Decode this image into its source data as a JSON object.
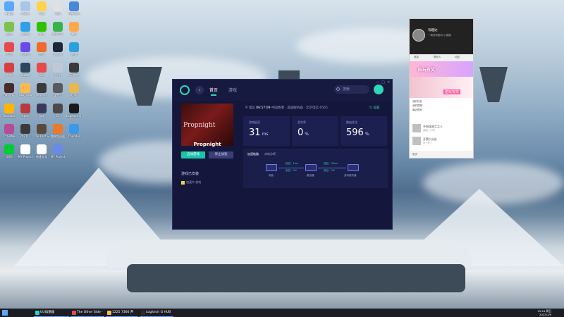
{
  "desktop": {
    "icons": [
      {
        "label": "计算机",
        "color": "#5aa7ff"
      },
      {
        "label": "回收站",
        "color": "#a8c6e8"
      },
      {
        "label": "工具",
        "color": "#ffd24a"
      },
      {
        "label": "文档",
        "color": "#e0e0e0"
      },
      {
        "label": "控制面板",
        "color": "#4a86d8"
      },
      {
        "label": "网盘",
        "color": "#7fc24a"
      },
      {
        "label": "浏览器",
        "color": "#2fa0e8"
      },
      {
        "label": "微信",
        "color": "#2dc100"
      },
      {
        "label": "安全卫士",
        "color": "#3ab34a"
      },
      {
        "label": "腾讯",
        "color": "#ffa94a"
      },
      {
        "label": "游戏",
        "color": "#e84a4a"
      },
      {
        "label": "加速器",
        "color": "#6a4ae8"
      },
      {
        "label": "音乐",
        "color": "#f06a2a"
      },
      {
        "label": "Steam",
        "color": "#1b2838"
      },
      {
        "label": "视频",
        "color": "#2aa0e0"
      },
      {
        "label": "雷神",
        "color": "#d84040"
      },
      {
        "label": "Steam",
        "color": "#2a475e"
      },
      {
        "label": "EA",
        "color": "#e84a4a"
      },
      {
        "label": "图片",
        "color": "#c0c8d8"
      },
      {
        "label": "云游戏",
        "color": "#3a3a3a"
      },
      {
        "label": "Dead by",
        "color": "#4a2a2a"
      },
      {
        "label": "WeGame",
        "color": "#ffb84a"
      },
      {
        "label": "Phasmo",
        "color": "#3a3a3a"
      },
      {
        "label": "游戏2",
        "color": "#5a5a5a"
      },
      {
        "label": "GTA",
        "color": "#e8b84a"
      },
      {
        "label": "Rockstar",
        "color": "#ffb400"
      },
      {
        "label": "Apex",
        "color": "#b83a3a"
      },
      {
        "label": "游戏",
        "color": "#3a3a5a"
      },
      {
        "label": "CF",
        "color": "#4a4a4a"
      },
      {
        "label": "Logitech G HUB",
        "color": "#1a1a1a"
      },
      {
        "label": "CYGAMe",
        "color": "#b84a9a"
      },
      {
        "label": "202111",
        "color": "#3a3a3a"
      },
      {
        "label": "The Last Sword",
        "color": "#5a4a3a"
      },
      {
        "label": "雷神加速器",
        "color": "#e87a2a"
      },
      {
        "label": "Thunder",
        "color": "#3a9ae8"
      },
      {
        "label": "iQIYI",
        "color": "#00cc36"
      },
      {
        "label": "MY Project",
        "color": "#ffffff"
      },
      {
        "label": "新建文本",
        "color": "#ffffff"
      },
      {
        "label": "MY Project",
        "color": "#6a8ae8"
      }
    ]
  },
  "app": {
    "tabs": [
      "首页",
      "游戏"
    ],
    "search_placeholder": "搜索",
    "window_controls": [
      "—",
      "□",
      "✕"
    ],
    "game": {
      "title": "Propnight",
      "poster_text": "Propnight",
      "primary_button": "启动游戏",
      "secondary_button": "停止加速"
    },
    "side": {
      "heading": "游戏已安装",
      "item": "加速中 游戏"
    },
    "status": {
      "prefix": "电信",
      "time": "06:57:09",
      "route": "中国香港 · 美国服务器 · 北京电信 6565"
    },
    "settings_label": "设置",
    "stats": [
      {
        "caption": "游戏延迟",
        "value": "31",
        "unit": "ms"
      },
      {
        "caption": "丢包率",
        "value": "0",
        "unit": "%"
      },
      {
        "caption": "路由优化",
        "value": "596",
        "unit": "%"
      }
    ],
    "panel": {
      "tabs": [
        "加速链路",
        "本地诊断"
      ],
      "nodes": [
        "电脑",
        "路由器",
        "游戏服务器"
      ],
      "links": [
        {
          "line1": "延迟：1ms",
          "line2": "丢包：0%"
        },
        {
          "line1": "延迟：30ms",
          "line2": "丢包：0%"
        }
      ]
    }
  },
  "chat": {
    "name": "有趣达",
    "subtitle": "一周游戏陪玩·小直播",
    "tabs": [
      "消息",
      "联系人",
      "动态"
    ],
    "banner": "陪玩有奖",
    "ad_tag": "陪玩有奖",
    "list_labels": [
      "我的好友",
      "我的群聊",
      "最近联系"
    ],
    "items": [
      {
        "name": "不同化双工之人",
        "msg": "[图片] 1:23"
      },
      {
        "name": "开黑小分队",
        "msg": "来了来了"
      }
    ],
    "footer": "更多"
  },
  "taskbar": {
    "items": [
      {
        "label": "UU加速器",
        "color": "#2fd6b8"
      },
      {
        "label": "The Other Side - ...",
        "color": "#e84a4a"
      },
      {
        "label": "1225 7366 开黑...",
        "color": "#ffb84a"
      },
      {
        "label": "Logitech G HUB",
        "color": "#2a2a2a"
      }
    ],
    "clock_time": "19:24 周日",
    "clock_date": "2022/1/9"
  }
}
